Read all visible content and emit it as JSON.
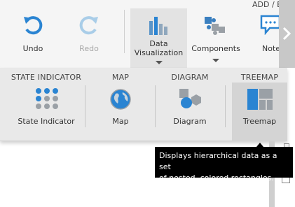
{
  "ribbon": {
    "undo_label": "Undo",
    "redo_label": "Redo",
    "data_viz_label_line1": "Data",
    "data_viz_label_line2": "Visualization",
    "components_label": "Components",
    "notes_label": "Note",
    "add_label": "ADD / E"
  },
  "panel": {
    "state_indicator": {
      "header": "STATE INDICATOR",
      "label": "State Indicator"
    },
    "map": {
      "header": "MAP",
      "label": "Map"
    },
    "diagram": {
      "header": "DIAGRAM",
      "label": "Diagram"
    },
    "treemap": {
      "header": "TREEMAP",
      "label": "Treemap"
    }
  },
  "tooltip": {
    "line1": "Displays hierarchical data as a set",
    "line2": "of nested, colored rectangles."
  },
  "colors": {
    "accent_blue": "#2a84d2",
    "disabled_blue": "#a9cde8",
    "gray_icon": "#9aa0a6",
    "component_blue": "#3a7fbf",
    "tooltip_bg": "#000000"
  },
  "icons": {
    "undo": "undo-icon",
    "redo": "redo-icon",
    "data_visualization": "bar-chart-icon",
    "components": "puzzle-icon",
    "notes": "note-icon",
    "state_indicator": "dot-grid-icon",
    "map": "globe-icon",
    "diagram": "diagram-icon",
    "treemap": "treemap-icon",
    "scroll": "chevron-right-icon"
  }
}
